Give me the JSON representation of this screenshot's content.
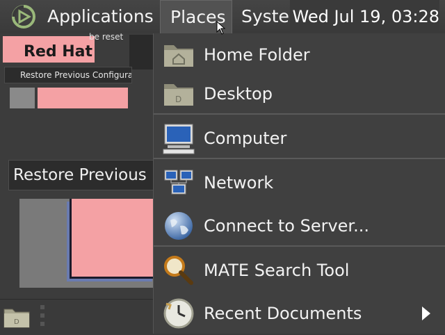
{
  "panel": {
    "applications_label": "Applications",
    "places_label": "Places",
    "system_label": "System",
    "clock": "Wed Jul 19, 03:28"
  },
  "background_window": {
    "reset_text": "be reset",
    "redhat_text": "Red Hat",
    "restore_small_label": "Restore Previous Configuration",
    "restore_big_label": "Restore Previous"
  },
  "places_menu": {
    "items": [
      {
        "label": "Home Folder",
        "icon": "home-folder-icon"
      },
      {
        "label": "Desktop",
        "icon": "desktop-folder-icon"
      },
      {
        "label": "Computer",
        "icon": "computer-icon"
      },
      {
        "label": "Network",
        "icon": "network-icon"
      },
      {
        "label": "Connect to Server...",
        "icon": "globe-icon"
      },
      {
        "label": "MATE Search Tool",
        "icon": "search-icon"
      },
      {
        "label": "Recent Documents",
        "icon": "clock-icon",
        "has_submenu": true
      }
    ]
  },
  "colors": {
    "panel_bg": "#3a3a3a",
    "menu_bg": "#404040",
    "accent_pink": "#f4a1a4",
    "mate_logo": "#9ab87a"
  }
}
